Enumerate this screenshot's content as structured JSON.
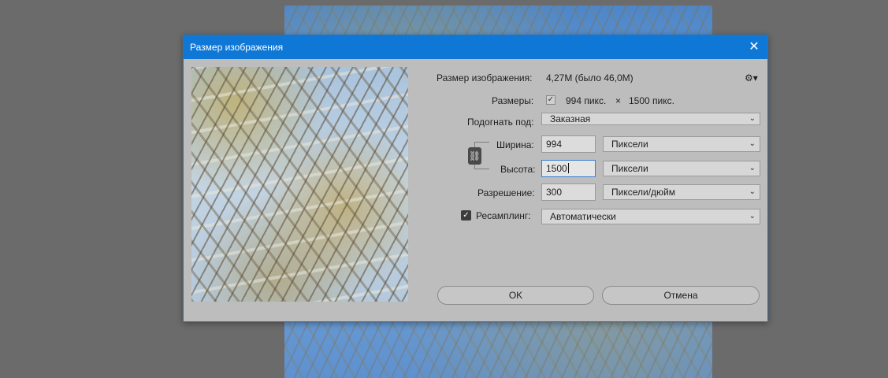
{
  "dialog": {
    "title": "Размер изображения",
    "close_glyph": "✕"
  },
  "image_size": {
    "label": "Размер изображения:",
    "value": "4,27M (было 46,0M)"
  },
  "dimensions": {
    "label": "Размеры:",
    "width": "994 пикс.",
    "times": "×",
    "height": "1500 пикс."
  },
  "fit_to": {
    "label": "Подогнать под:",
    "selected": "Заказная"
  },
  "width": {
    "label": "Ширина:",
    "value": "994",
    "unit": "Пиксели"
  },
  "height": {
    "label": "Высота:",
    "value": "1500",
    "unit": "Пиксели"
  },
  "resolution": {
    "label": "Разрешение:",
    "value": "300",
    "unit": "Пиксели/дюйм"
  },
  "resample": {
    "label": "Ресамплинг:",
    "checked": true,
    "selected": "Автоматически"
  },
  "buttons": {
    "ok": "OK",
    "cancel": "Отмена"
  },
  "icons": {
    "gear": "gear-icon",
    "link": "chain-link-icon",
    "chevron": "chevron-down-icon"
  },
  "colors": {
    "title_bar": "#0f78d7",
    "dialog_bg": "#bdbdbd",
    "workspace_bg": "#6b6b6b"
  }
}
